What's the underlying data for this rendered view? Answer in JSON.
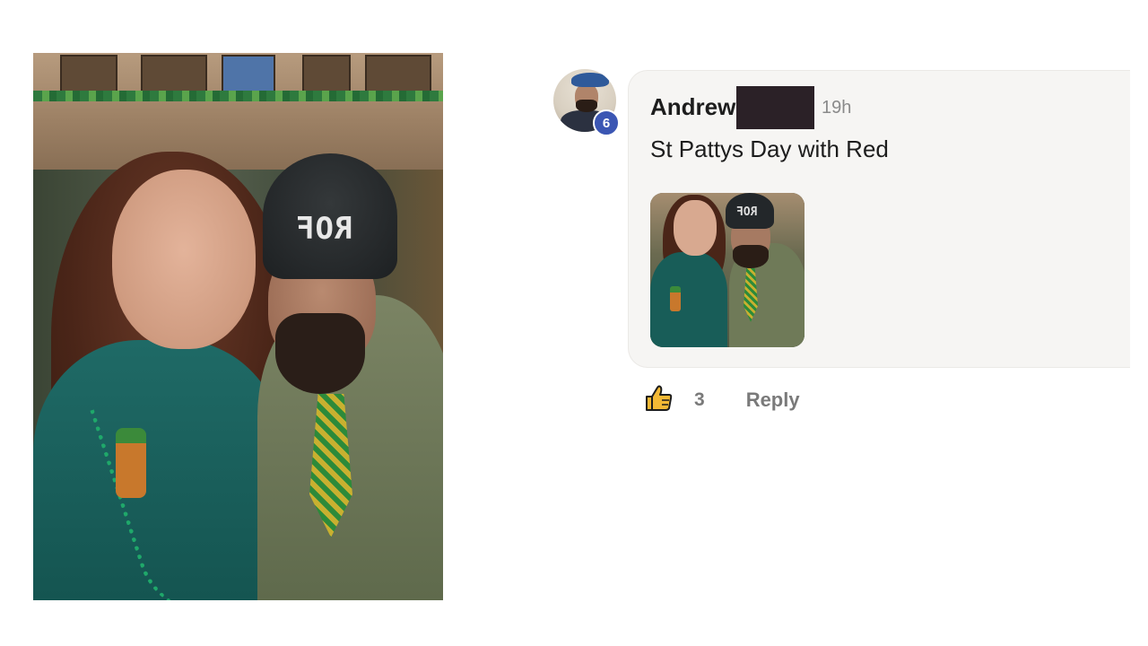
{
  "post": {
    "image_alt": "Selfie of a woman and a man in green St. Patrick's Day outfits in a bar",
    "beanie_text": "ROF"
  },
  "comment": {
    "author": "Andrew",
    "time": "19h",
    "text": "St Pattys Day with Red",
    "avatar_badge": "6",
    "likes": "3",
    "reply_label": "Reply"
  },
  "icons": {
    "like": "thumbs-up-icon"
  },
  "colors": {
    "badge": "#3b56b3",
    "bubble_bg": "#f6f5f3",
    "like_icon": "#f3b935"
  }
}
